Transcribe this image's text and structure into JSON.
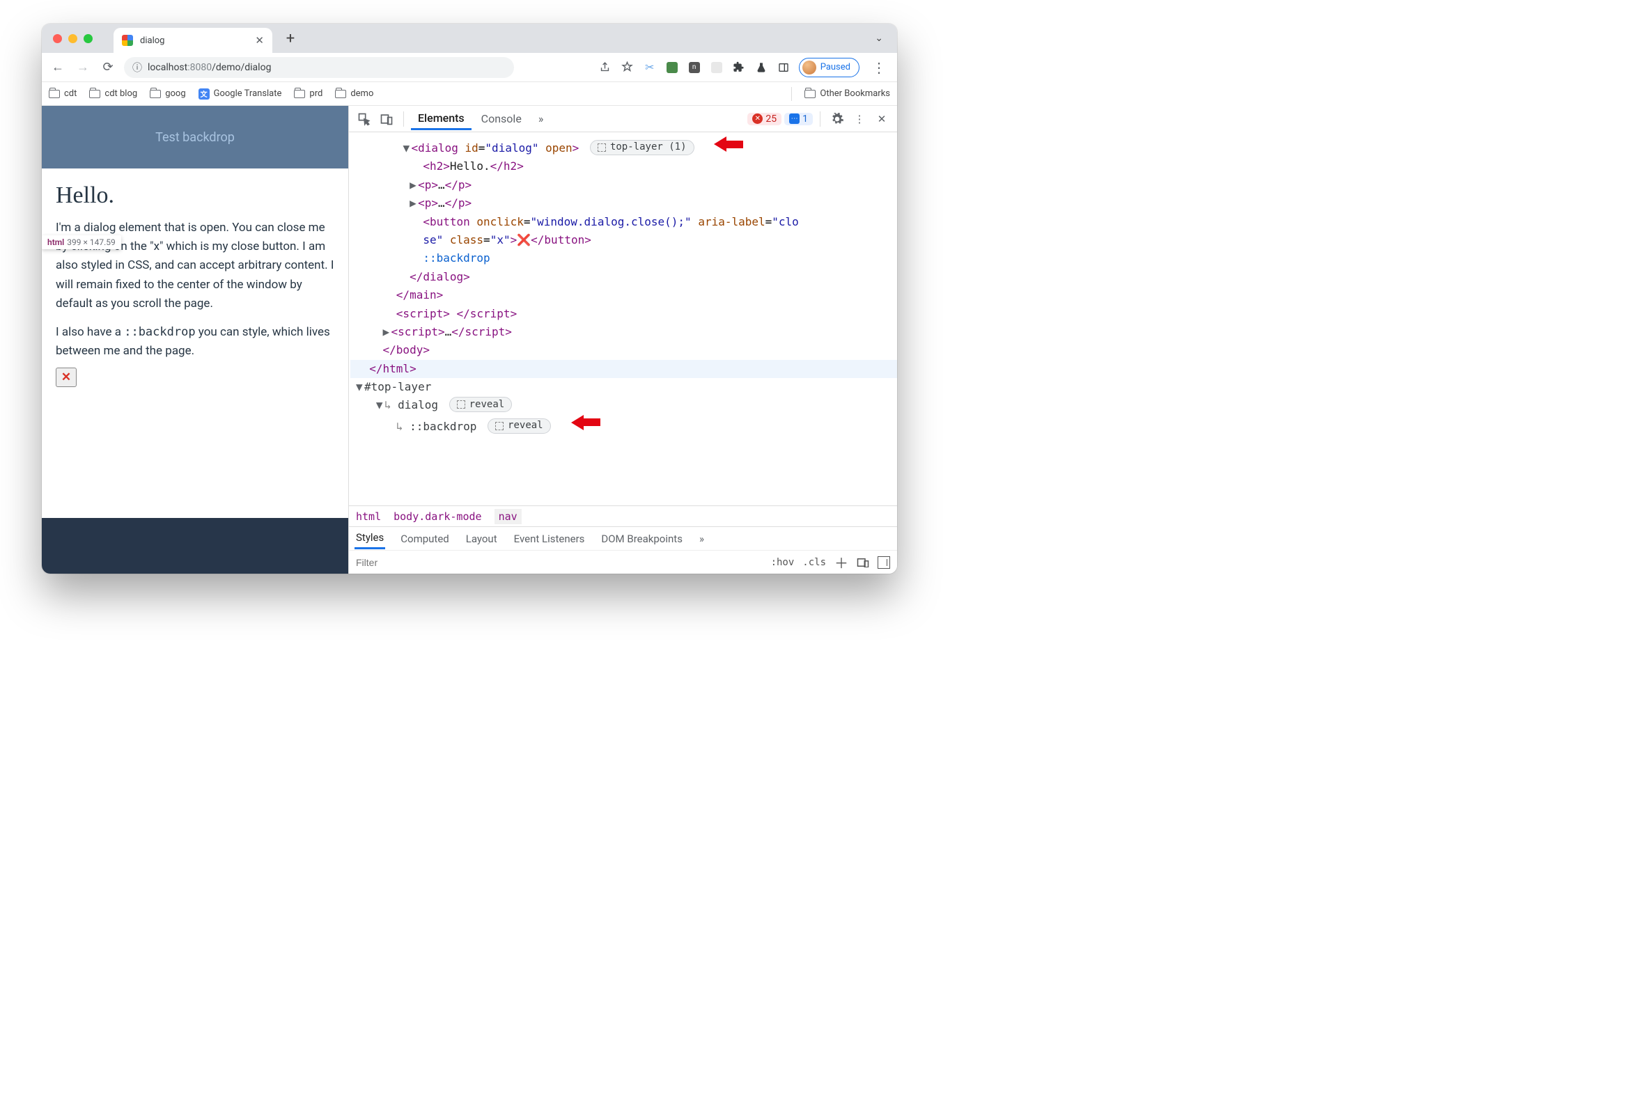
{
  "browser": {
    "tab_title": "dialog",
    "url_host": "localhost",
    "url_port": ":8080",
    "url_path": "/demo/dialog",
    "profile_status": "Paused",
    "bookmarks": [
      "cdt",
      "cdt blog",
      "goog",
      "Google Translate",
      "prd",
      "demo"
    ],
    "other_bookmarks": "Other Bookmarks"
  },
  "page": {
    "banner": "Test backdrop",
    "h2": "Hello.",
    "tooltip_label": "html",
    "tooltip_dims": "399 × 147.59",
    "p1": "I'm a dialog element that is open. You can close me by clicking on the \"x\" which is my close button. I am also styled in CSS, and can accept arbitrary content. I will remain fixed to the center of the window by default as you scroll the page.",
    "p2a": "I also have a ",
    "p2code": "::backdrop",
    "p2b": " you can style, which lives between me and the page.",
    "close_x": "✕"
  },
  "devtools": {
    "tabs": {
      "elements": "Elements",
      "console": "Console"
    },
    "more": "»",
    "errors": "25",
    "messages": "1",
    "dom": {
      "dialog_open": "<dialog id=\"dialog\" open>",
      "toplayer_badge": "top-layer (1)",
      "h2_line": "<h2>Hello.</h2>",
      "p_collapsed": "<p>…</p>",
      "button_line1": "<button onclick=\"window.dialog.close();\" aria-label=\"clo",
      "button_line2": "se\" class=\"x\">",
      "button_x": "❌",
      "button_close": "</button>",
      "backdrop": "::backdrop",
      "dialog_close": "</dialog>",
      "main_close": "</main>",
      "script_empty": "<script> </script>",
      "script_collapsed": "<script>…</script>",
      "body_close": "</body>",
      "html_close": "</html>",
      "toplayer_section": "#top-layer",
      "tl_dialog": "dialog",
      "tl_backdrop": "::backdrop",
      "reveal": "reveal"
    },
    "crumbs": {
      "c1": "html",
      "c2": "body.dark-mode",
      "c3": "nav"
    },
    "styles_tabs": [
      "Styles",
      "Computed",
      "Layout",
      "Event Listeners",
      "DOM Breakpoints"
    ],
    "filter_placeholder": "Filter",
    "hov": ":hov",
    "cls": ".cls"
  }
}
